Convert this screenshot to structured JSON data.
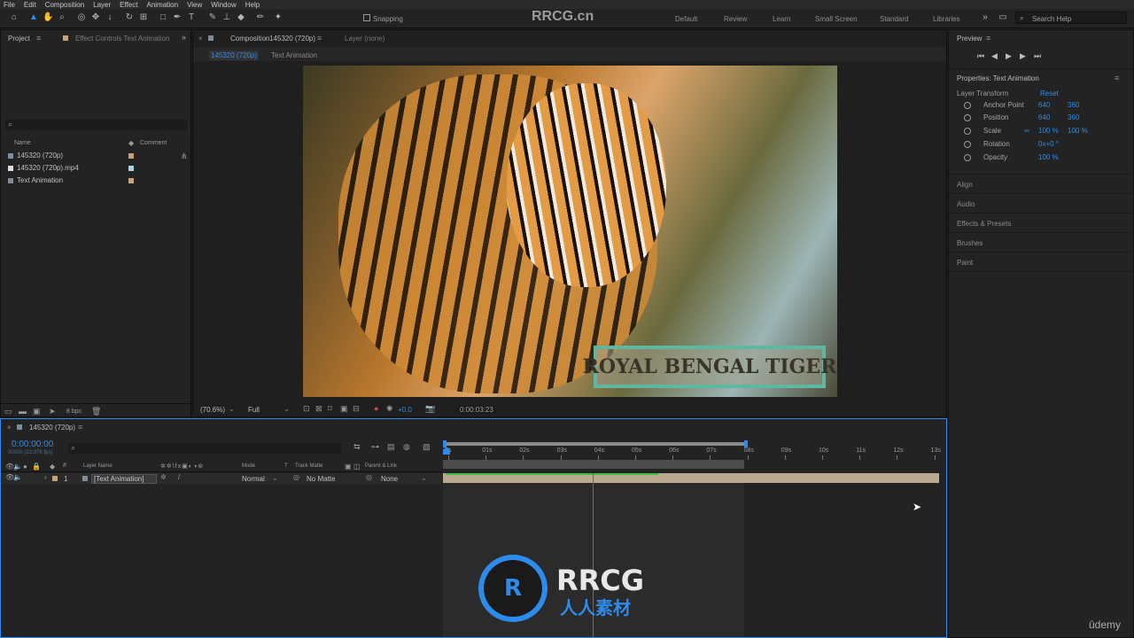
{
  "menu": [
    "File",
    "Edit",
    "Composition",
    "Layer",
    "Effect",
    "Animation",
    "View",
    "Window",
    "Help"
  ],
  "toolbar": {
    "snapping": "Snapping",
    "workspaces": [
      "Default",
      "Review",
      "Learn",
      "Small Screen",
      "Standard",
      "Libraries"
    ],
    "search_placeholder": "Search Help"
  },
  "project_panel": {
    "tab": "Project",
    "effect_controls_tab": "Effect Controls Text Animation",
    "col_name": "Name",
    "col_comment": "Comment",
    "items": [
      {
        "name": "145320 (720p)",
        "color": "#c9a27a"
      },
      {
        "name": "145320 (720p).mp4",
        "color": "#a9d6e0"
      },
      {
        "name": "Text Animation",
        "color": "#c9a27a"
      }
    ],
    "bpc": "8 bpc"
  },
  "composition_panel": {
    "tab_label": "Composition",
    "tab_name": "145320 (720p)",
    "layer_tab": "Layer (none)",
    "breadcrumb_1": "145320 (720p)",
    "breadcrumb_2": "Text Animation",
    "viewer_text": "ROYAL BENGAL TIGER",
    "zoom": "(70.6%)",
    "resolution": "Full",
    "exposure": "+0.0",
    "timecode": "0:00:03:23"
  },
  "preview_panel": {
    "title": "Preview"
  },
  "properties_panel": {
    "title": "Properties: Text Animation",
    "section": "Layer Transform",
    "reset": "Reset",
    "rows": [
      {
        "label": "Anchor Point",
        "v1": "640",
        "v2": "360"
      },
      {
        "label": "Position",
        "v1": "640",
        "v2": "360"
      },
      {
        "label": "Scale",
        "v1": "100 %",
        "v2": "100 %"
      },
      {
        "label": "Rotation",
        "v1": "0x+0 °",
        "v2": ""
      },
      {
        "label": "Opacity",
        "v1": "100 %",
        "v2": ""
      }
    ],
    "collapsed": [
      "Align",
      "Audio",
      "Effects & Presets",
      "Brushes",
      "Paint"
    ]
  },
  "timeline": {
    "tab": "145320 (720p)",
    "timecode": "0:00:00:00",
    "fps": "00000 (23.976 fps)",
    "col_layer_name": "Layer Name",
    "col_mode": "Mode",
    "col_t": "T",
    "col_track_matte": "Track Matte",
    "col_parent": "Parent & Link",
    "ruler": [
      "0s",
      "01s",
      "02s",
      "03s",
      "04s",
      "05s",
      "06s",
      "07s",
      "08s",
      "09s",
      "10s",
      "11s",
      "12s",
      "13s"
    ],
    "layer": {
      "index": "1",
      "name": "[Text Animation]",
      "mode": "Normal",
      "matte": "No Matte",
      "parent": "None"
    }
  },
  "overlay": {
    "logo_text": "RRCG",
    "logo_sub": "人人素材",
    "site": "RRCG.cn",
    "udemy": "ûdemy"
  },
  "colors": {
    "accent": "#2d8ceb",
    "layer_bar": "#b9a98f",
    "work_area": "#3a3a3a",
    "playhead": "#e03a3a",
    "text_box": "#5fb7a0"
  }
}
